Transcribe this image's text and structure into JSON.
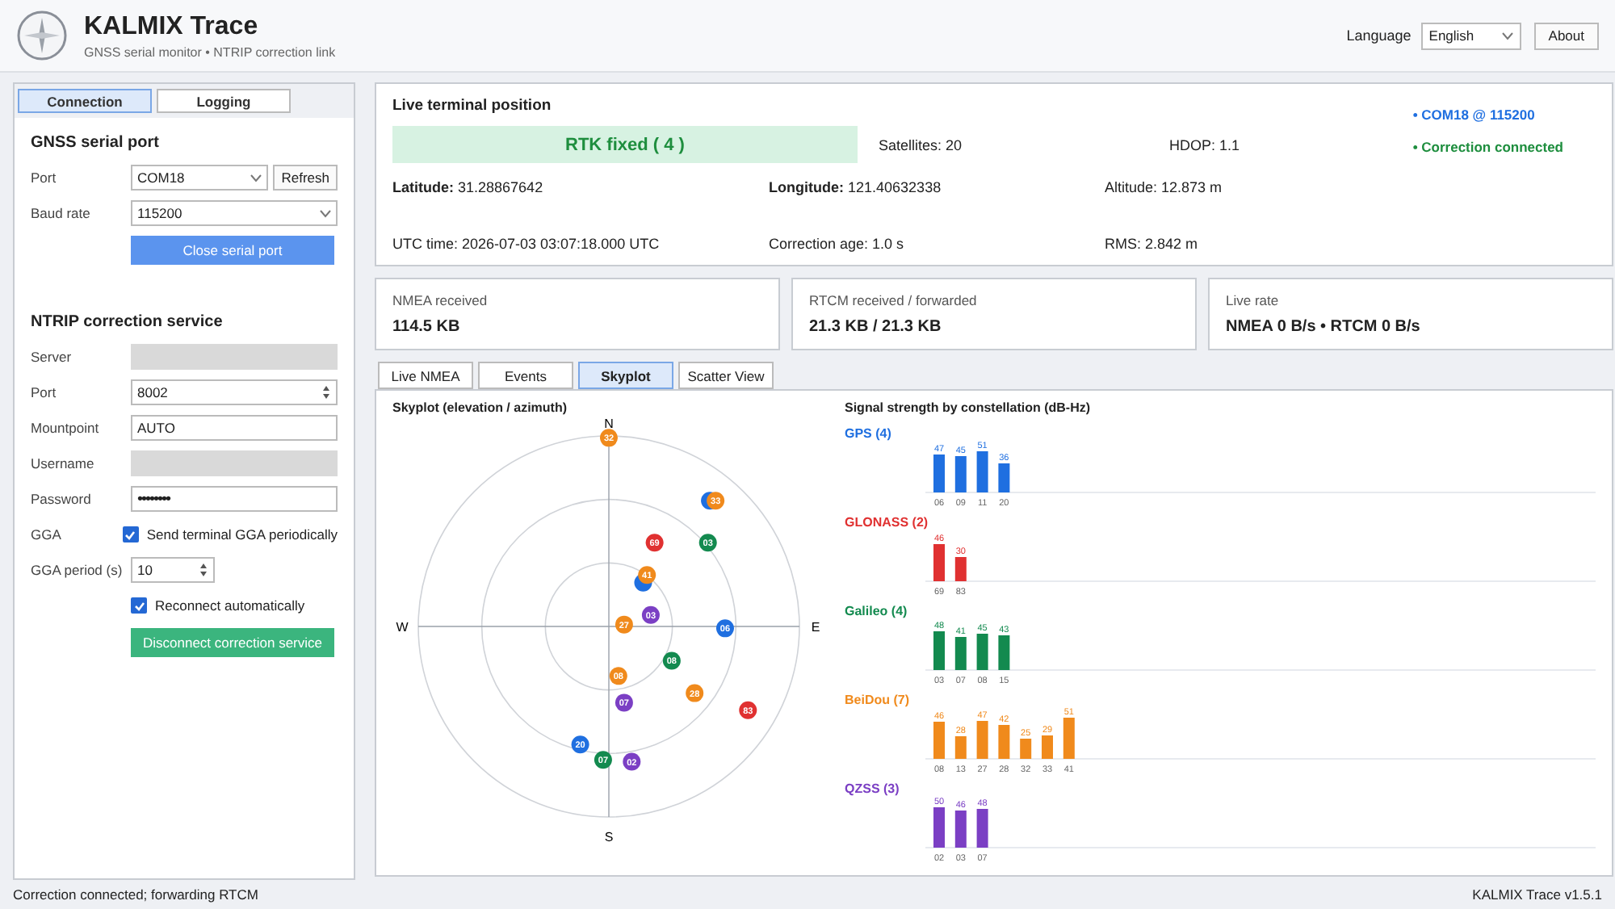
{
  "header": {
    "title": "KALMIX Trace",
    "subtitle": "GNSS serial monitor • NTRIP correction link",
    "language_label": "Language",
    "language": "English",
    "about": "About"
  },
  "side_tabs": [
    {
      "label": "Connection",
      "selected": true
    },
    {
      "label": "Logging",
      "selected": false
    }
  ],
  "serial": {
    "heading": "GNSS serial port",
    "rows": [
      {
        "kind": "select",
        "label": "Port",
        "value": "COM18",
        "button": "Refresh"
      },
      {
        "kind": "select",
        "label": "Baud rate",
        "value": "115200"
      }
    ],
    "action": "Close serial port"
  },
  "ntrip": {
    "heading": "NTRIP correction service",
    "rows": [
      {
        "kind": "blank",
        "label": "Server"
      },
      {
        "kind": "spin",
        "label": "Port",
        "value": "8002"
      },
      {
        "kind": "text",
        "label": "Mountpoint",
        "value": "AUTO"
      },
      {
        "kind": "blank",
        "label": "Username"
      },
      {
        "kind": "password",
        "label": "Password",
        "value": "••••••••"
      },
      {
        "kind": "checkbox",
        "label": "GGA",
        "text": "Send terminal GGA periodically",
        "checked": true
      },
      {
        "kind": "spin",
        "label": "GGA period (s)",
        "value": "10"
      },
      {
        "kind": "checkbox",
        "text": "Reconnect automatically",
        "checked": true
      }
    ],
    "action": "Disconnect correction service"
  },
  "position": {
    "title": "Live terminal position",
    "fix": "RTK fixed ( 4 )",
    "satellites": "Satellites: 20",
    "hdop": "HDOP: 1.1",
    "latitude_label": "Latitude:",
    "latitude": "31.28867642",
    "longitude_label": "Longitude:",
    "longitude": "121.40632338",
    "altitude": "Altitude: 12.873 m",
    "utc": "UTC time: 2026-07-03 03:07:18.000 UTC",
    "correction_age": "Correction age: 1.0 s",
    "rms": "RMS: 2.842 m",
    "indicators": [
      {
        "text": "• COM18 @ 115200",
        "color": "#1f6fe0"
      },
      {
        "text": "• Correction connected",
        "color": "#1e8e3e"
      }
    ]
  },
  "stats": [
    {
      "label": "NMEA received",
      "value": "114.5 KB"
    },
    {
      "label": "RTCM received / forwarded",
      "value": "21.3 KB / 21.3 KB"
    },
    {
      "label": "Live rate",
      "value": "NMEA 0 B/s • RTCM 0 B/s"
    }
  ],
  "main_tabs": [
    {
      "label": "Live NMEA",
      "selected": false
    },
    {
      "label": "Events",
      "selected": false
    },
    {
      "label": "Skyplot",
      "selected": true
    },
    {
      "label": "Scatter View",
      "selected": false
    }
  ],
  "skyplot": {
    "title": "Skyplot (elevation / azimuth)",
    "compass": [
      "N",
      "E",
      "S",
      "W"
    ],
    "satellites": [
      {
        "label": "32",
        "color": "#f08a1c"
      },
      {
        "color": "#1f6fe0"
      },
      {
        "label": "33",
        "color": "#f08a1c"
      },
      {
        "label": "69",
        "color": "#e03131"
      },
      {
        "label": "03",
        "color": "#138a4f"
      },
      {
        "color": "#1f6fe0"
      },
      {
        "label": "41",
        "color": "#f08a1c"
      },
      {
        "label": "03",
        "color": "#7b3fc4"
      },
      {
        "label": "27",
        "color": "#f08a1c"
      },
      {
        "label": "06",
        "color": "#1f6fe0"
      },
      {
        "label": "08",
        "color": "#138a4f"
      },
      {
        "label": "08",
        "color": "#f08a1c"
      },
      {
        "label": "28",
        "color": "#f08a1c"
      },
      {
        "label": "07",
        "color": "#7b3fc4"
      },
      {
        "label": "83",
        "color": "#e03131"
      },
      {
        "label": "20",
        "color": "#1f6fe0"
      },
      {
        "label": "07",
        "color": "#138a4f"
      },
      {
        "label": "02",
        "color": "#7b3fc4"
      }
    ]
  },
  "signal": {
    "title": "Signal strength by constellation (dB-Hz)",
    "constellations": [
      {
        "chart_data": {
          "type": "bar",
          "title": "GPS (4)",
          "categories": [
            "06",
            "09",
            "11",
            "20"
          ],
          "series": [
            {
              "color": "#1f6fe0",
              "values": [
                47,
                45,
                51,
                36
              ]
            }
          ],
          "data_labels": true
        }
      },
      {
        "chart_data": {
          "type": "bar",
          "title": "GLONASS (2)",
          "categories": [
            "69",
            "83"
          ],
          "series": [
            {
              "color": "#e03131",
              "values": [
                46,
                30
              ]
            }
          ],
          "data_labels": true
        }
      },
      {
        "chart_data": {
          "type": "bar",
          "title": "Galileo (4)",
          "categories": [
            "03",
            "07",
            "08",
            "15"
          ],
          "series": [
            {
              "color": "#138a4f",
              "values": [
                48,
                41,
                45,
                43
              ]
            }
          ],
          "data_labels": true
        }
      },
      {
        "chart_data": {
          "type": "bar",
          "title": "BeiDou (7)",
          "categories": [
            "08",
            "13",
            "27",
            "28",
            "32",
            "33",
            "41"
          ],
          "series": [
            {
              "color": "#f08a1c",
              "values": [
                46,
                28,
                47,
                42,
                25,
                29,
                51
              ]
            }
          ],
          "data_labels": true
        }
      },
      {
        "chart_data": {
          "type": "bar",
          "title": "QZSS (3)",
          "categories": [
            "02",
            "03",
            "07"
          ],
          "series": [
            {
              "color": "#7b3fc4",
              "values": [
                50,
                46,
                48
              ]
            }
          ],
          "data_labels": true
        }
      }
    ]
  },
  "status_bar": {
    "message": "Correction connected; forwarding RTCM",
    "version": "KALMIX Trace v1.5.1"
  }
}
